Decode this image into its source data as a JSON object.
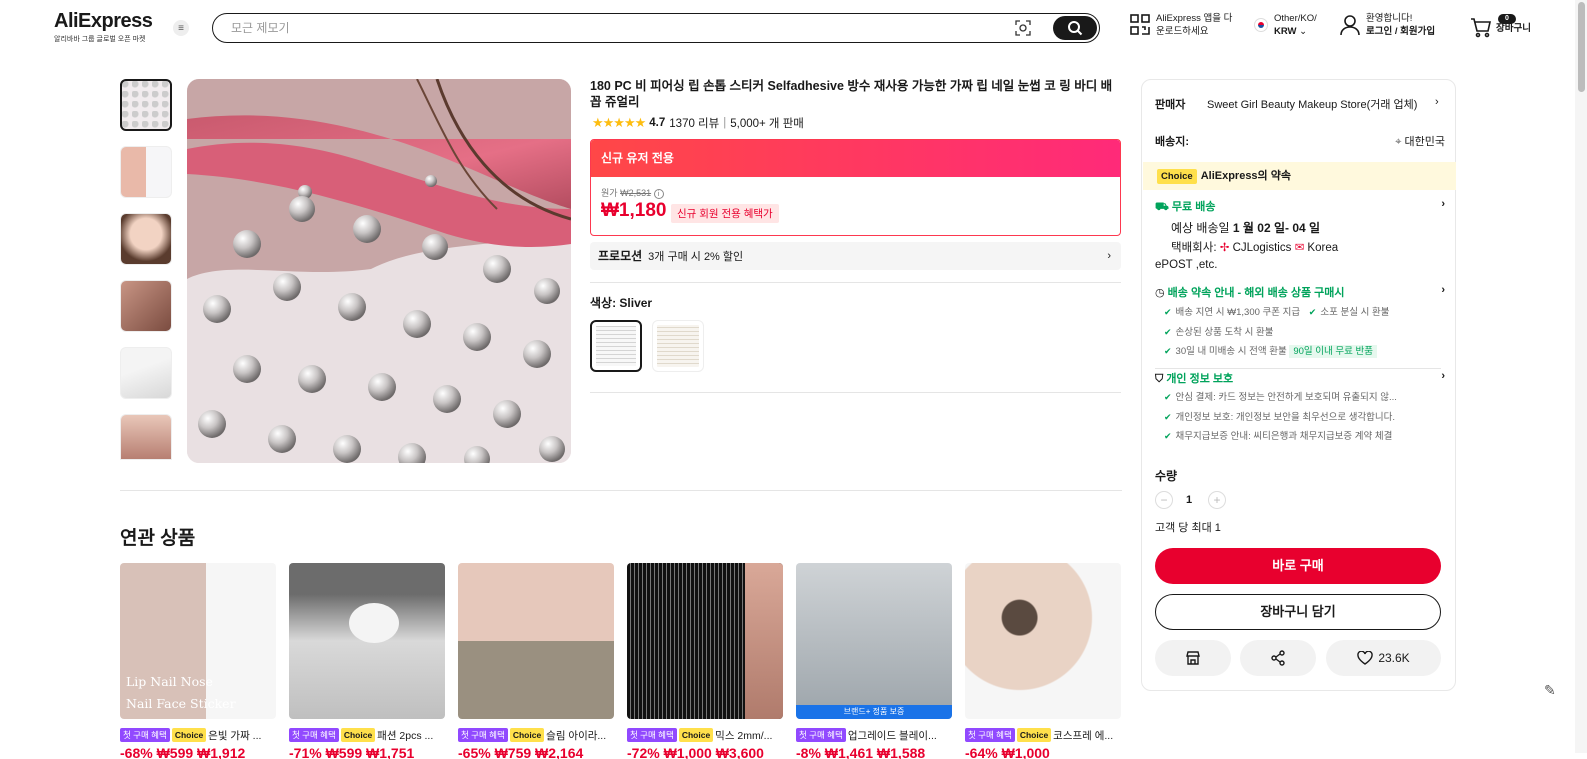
{
  "header": {
    "logo": "AliExpress",
    "logo_sub": "알리바바 그룹 글로벌 오픈 마켓",
    "search_placeholder": "모근 제모기",
    "app_line1": "AliExpress 앱을 다",
    "app_line2": "운로드하세요",
    "region_line1": "Other/KO/",
    "region_line2": "KRW",
    "account_line1": "환영합니다!",
    "account_line2": "로그인 / 회원가입",
    "cart_count": "0",
    "cart_label": "장바구니"
  },
  "product": {
    "title": "180 PC 비 피어싱 립 손톱 스티커 Selfadhesive 방수 재사용 가능한 가짜 립 네일 눈썹 코 링 바디 배꼽 쥬얼리",
    "rating": "4.7",
    "reviews": "1370 리뷰",
    "sold": "5,000+ 개 판매",
    "promo_header": "신규 유저 전용",
    "orig_label": "원가",
    "orig_price": "₩2,531",
    "price": "₩1,180",
    "price_tag": "신규 회원 전용 혜택가",
    "promotion_label": "프로모션",
    "promotion_text": "3개 구매 시 2% 할인",
    "color_label": "색상: Sliver"
  },
  "panel": {
    "seller_label": "판매자",
    "seller_name": "Sweet Girl Beauty Makeup Store(거래 업체)",
    "ship_to_label": "배송지:",
    "ship_to_value": "대한민국",
    "choice_tag": "Choice",
    "choice_text": "AliExpress의 약속",
    "free_ship": "무료 배송",
    "est_delivery_prefix": "예상 배송일",
    "est_delivery_date": "1 월 02 일- 04 일",
    "carrier_label": "택배회사:",
    "carrier1": "CJLogistics",
    "carrier2": "Korea",
    "carrier3": "ePOST ,etc.",
    "promise_title": "배송 약속 안내 - 해외 배송 상품 구매시",
    "promise_items": [
      "배송 지연 시 ₩1,300 쿠폰 지급",
      "소포 분실 시 환불",
      "손상된 상품 도착 시 환불",
      "30일 내 미배송 시 전액 환불"
    ],
    "promise_badge": "90일 이내 무료 반품",
    "privacy_title": "개인 정보 보호",
    "privacy_items": [
      "안심 결제: 카드 정보는 안전하게 보호되며 유출되지 않...",
      "개인정보 보호: 개인정보 보안을 최우선으로 생각합니다.",
      "채무지급보증 안내: 씨티은행과 채무지급보증 계약 체결"
    ],
    "qty_label": "수량",
    "qty_value": "1",
    "qty_limit": "고객 당 최대 1",
    "buy_now": "바로 구매",
    "add_cart": "장바구니 담기",
    "wishlist_count": "23.6K"
  },
  "related": {
    "title": "연관 상품",
    "first_tag": "첫 구매 혜택",
    "choice_tag": "Choice",
    "items": [
      {
        "name": "은빛 가짜 ...",
        "price": "-68% ₩599 ₩1,912",
        "img_text1": "Lip Nail Nose",
        "img_text2": "Nail Face Sticker"
      },
      {
        "name": "패션 2pcs ...",
        "price": "-71% ₩599 ₩1,751"
      },
      {
        "name": "슬림 아이라...",
        "price": "-65% ₩759 ₩2,164"
      },
      {
        "name": "믹스 2mm/...",
        "price": "-72% ₩1,000 ₩3,600"
      },
      {
        "name": "업그레이드 블레이...",
        "price": "-8% ₩1,461 ₩1,588",
        "img_badge": "브랜드+ 정품 보증"
      },
      {
        "name": "코스프레 에...",
        "price": "-64% ₩1,000"
      }
    ]
  },
  "colors": {
    "accent": "#e8002e",
    "green": "#00a35b",
    "choice": "#ffe04b"
  }
}
